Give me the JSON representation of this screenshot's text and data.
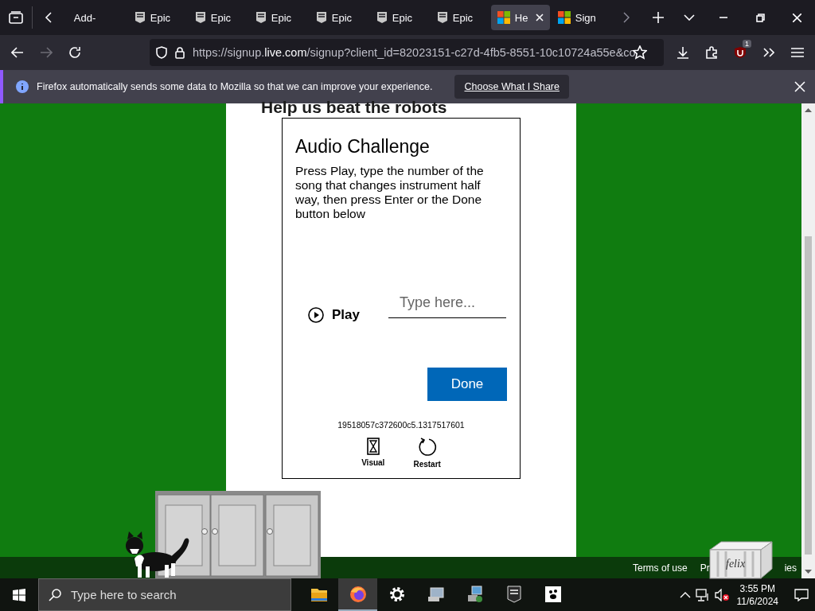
{
  "browser": {
    "tabs": [
      {
        "label": "Add-",
        "kind": "plain",
        "selected": false
      },
      {
        "label": "Epic",
        "kind": "epic",
        "selected": false
      },
      {
        "label": "Epic",
        "kind": "epic",
        "selected": false
      },
      {
        "label": "Epic",
        "kind": "epic",
        "selected": false
      },
      {
        "label": "Epic",
        "kind": "epic",
        "selected": false
      },
      {
        "label": "Epic",
        "kind": "epic",
        "selected": false
      },
      {
        "label": "Epic",
        "kind": "epic",
        "selected": false
      },
      {
        "label": "He",
        "kind": "microsoft",
        "selected": true
      },
      {
        "label": "Sign",
        "kind": "microsoft",
        "selected": false
      }
    ],
    "url": {
      "prefix": "https://signup.",
      "domain": "live.com",
      "path": "/signup?client_id=82023151-c27d-4fb5-8551-10c10724a55e&co"
    },
    "extension_badge": "1"
  },
  "notification": {
    "message": "Firefox automatically sends some data to Mozilla so that we can improve your experience.",
    "button": "Choose What I Share"
  },
  "page": {
    "heading": "Help us beat the robots",
    "challenge": {
      "title": "Audio Challenge",
      "instructions": "Press Play, type the number of the song that changes instrument half way, then press Enter or the Done button below",
      "play": "Play",
      "answer": {
        "placeholder": "Type here..."
      },
      "done": "Done",
      "session_id": "19518057c372600c5.1317517601",
      "options": [
        {
          "label": "Visual",
          "kind": "visual"
        },
        {
          "label": "Restart",
          "kind": "restart"
        }
      ]
    },
    "footer_links": [
      "Terms of use",
      "Pr",
      "ies"
    ]
  },
  "desktop_pets": {
    "box_label": "felix"
  },
  "taskbar": {
    "search": {
      "placeholder": "Type here to search"
    },
    "apps": [
      {
        "kind": "folder",
        "selected": false
      },
      {
        "kind": "firefox",
        "selected": true
      },
      {
        "kind": "settings",
        "selected": false
      },
      {
        "kind": "computer",
        "selected": false
      },
      {
        "kind": "network",
        "selected": false
      },
      {
        "kind": "epic",
        "selected": false
      },
      {
        "kind": "paw",
        "selected": false
      }
    ],
    "clock": {
      "time": "3:55 PM",
      "date": "11/6/2024"
    }
  }
}
